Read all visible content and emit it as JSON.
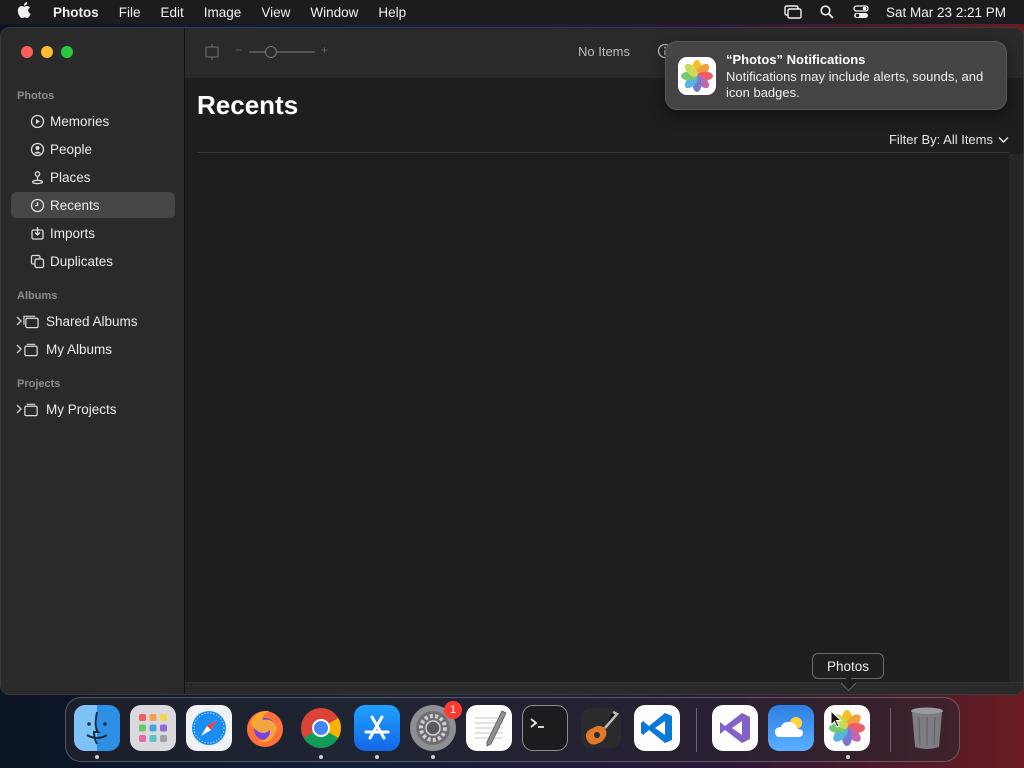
{
  "menubar": {
    "app_name": "Photos",
    "menus": [
      "File",
      "Edit",
      "Image",
      "View",
      "Window",
      "Help"
    ],
    "clock": "Sat Mar 23  2:21 PM"
  },
  "toolbar": {
    "zoom_minus": "−",
    "zoom_plus": "+",
    "item_count": "No Items"
  },
  "sidebar": {
    "section_photos": "Photos",
    "items": [
      {
        "label": "Memories",
        "icon": "memories-icon"
      },
      {
        "label": "People",
        "icon": "people-icon"
      },
      {
        "label": "Places",
        "icon": "places-icon"
      },
      {
        "label": "Recents",
        "icon": "clock-icon",
        "selected": true
      },
      {
        "label": "Imports",
        "icon": "imports-icon"
      },
      {
        "label": "Duplicates",
        "icon": "duplicates-icon"
      }
    ],
    "section_albums": "Albums",
    "albums": [
      {
        "label": "Shared Albums"
      },
      {
        "label": "My Albums"
      }
    ],
    "section_projects": "Projects",
    "projects": [
      {
        "label": "My Projects"
      }
    ]
  },
  "main": {
    "title": "Recents",
    "filter_label": "Filter By: All Items"
  },
  "notification": {
    "title": "“Photos” Notifications",
    "body": "Notifications may include alerts, sounds, and icon badges."
  },
  "dock": {
    "tooltip": "Photos",
    "badge_count": "1",
    "apps": [
      "finder",
      "launchpad",
      "safari",
      "firefox",
      "chrome",
      "app-store",
      "system-settings",
      "textedit",
      "terminal",
      "garageband",
      "vscode",
      "visual-studio",
      "weather",
      "photos",
      "trash"
    ]
  },
  "colors": {
    "window_bg": "#1e1e1e",
    "sidebar_bg": "#2a2a2b",
    "selected_bg": "#464648",
    "badge": "#ff3b30"
  }
}
